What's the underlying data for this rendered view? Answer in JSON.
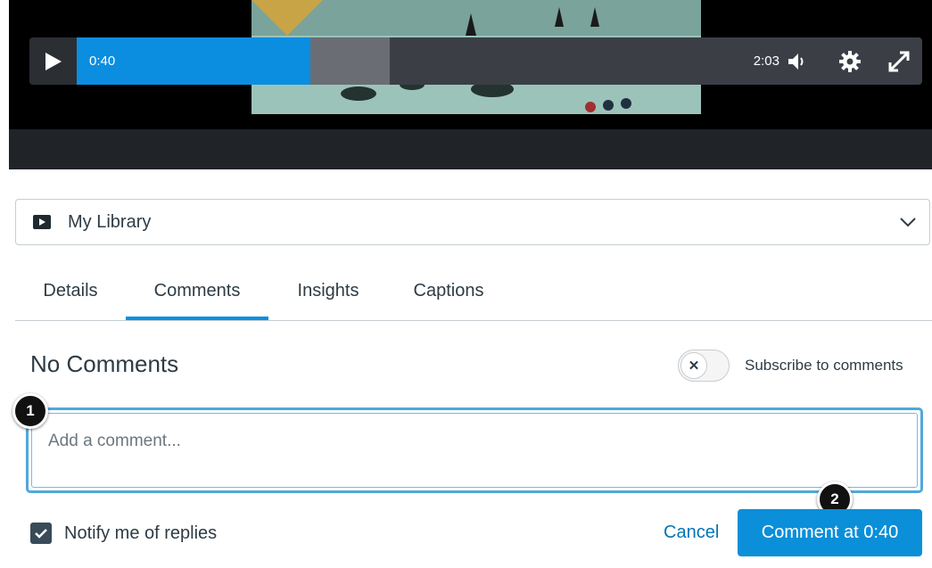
{
  "player": {
    "current_time": "0:40",
    "duration": "2:03",
    "played_fraction": 0.325,
    "buffered_fraction": 0.435,
    "icons": [
      "play-icon",
      "volume-icon",
      "gear-icon",
      "fullscreen-icon"
    ]
  },
  "library": {
    "label": "My Library",
    "icon": "video-icon"
  },
  "tabs": [
    {
      "label": "Details",
      "active": false
    },
    {
      "label": "Comments",
      "active": true
    },
    {
      "label": "Insights",
      "active": false
    },
    {
      "label": "Captions",
      "active": false
    }
  ],
  "comments": {
    "heading": "No Comments",
    "subscribe_label": "Subscribe to comments",
    "subscribe_on": false,
    "input_placeholder": "Add a comment...",
    "notify_label": "Notify me of replies",
    "notify_checked": true,
    "cancel_label": "Cancel",
    "submit_label": "Comment at 0:40"
  },
  "callouts": [
    "1",
    "2"
  ],
  "colors": {
    "accent": "#0b8ee0",
    "link": "#0374b5",
    "text": "#2d3b45"
  }
}
